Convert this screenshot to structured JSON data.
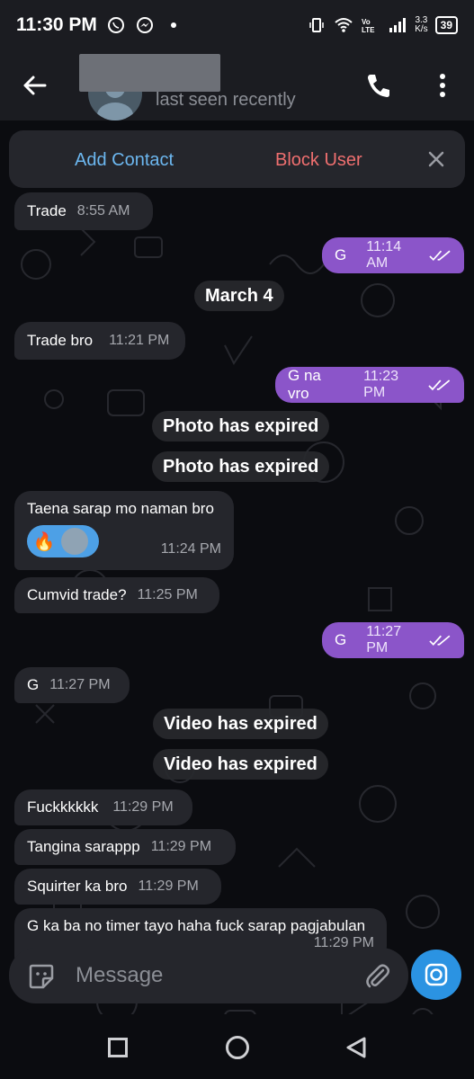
{
  "status_bar": {
    "time": "11:30 PM",
    "net_speed_top": "3.3",
    "net_speed_bottom": "K/s",
    "battery": "39",
    "icons": [
      "whatsapp-icon",
      "messenger-icon",
      "dot-icon",
      "vibrate-icon",
      "wifi-icon",
      "volte-icon",
      "signal-icon"
    ]
  },
  "header": {
    "status": "last seen recently",
    "icons": [
      "back-arrow-icon",
      "phone-icon",
      "more-vert-icon"
    ]
  },
  "contact_bar": {
    "add_contact": "Add Contact",
    "block_user": "Block User"
  },
  "messages": [
    {
      "dir": "in",
      "text": "Trade",
      "time": "8:55 AM"
    },
    {
      "dir": "out",
      "text": "G",
      "time": "11:14 AM",
      "read": true
    },
    {
      "dir": "date",
      "text": "March 4"
    },
    {
      "dir": "in",
      "text": "Trade bro",
      "time": "11:21 PM"
    },
    {
      "dir": "out",
      "text": "G na vro",
      "time": "11:23 PM",
      "read": true
    },
    {
      "dir": "system",
      "text": "Photo has expired"
    },
    {
      "dir": "system",
      "text": "Photo has expired"
    },
    {
      "dir": "in",
      "text": "Taena sarap mo naman bro",
      "time": "11:24 PM",
      "reaction": "🔥"
    },
    {
      "dir": "in",
      "text": "Cumvid trade?",
      "time": "11:25 PM"
    },
    {
      "dir": "out",
      "text": "G",
      "time": "11:27 PM",
      "read": true
    },
    {
      "dir": "in",
      "text": "G",
      "time": "11:27 PM"
    },
    {
      "dir": "system",
      "text": "Video has expired"
    },
    {
      "dir": "system",
      "text": "Video has expired"
    },
    {
      "dir": "in",
      "text": "Fuckkkkkk",
      "time": "11:29 PM"
    },
    {
      "dir": "in",
      "text": "Tangina sarappp",
      "time": "11:29 PM"
    },
    {
      "dir": "in",
      "text": "Squirter ka bro",
      "time": "11:29 PM"
    },
    {
      "dir": "in",
      "text": "G ka ba no timer tayo haha fuck sarap pagjabulan",
      "time": "11:29 PM"
    }
  ],
  "composer": {
    "placeholder": "Message",
    "icons": [
      "sticker-icon",
      "paperclip-icon",
      "camera-icon"
    ]
  },
  "colors": {
    "outgoing_bubble": "#8b55c9",
    "incoming_bubble": "#25262c",
    "accent_blue": "#2b93e2",
    "add_contact": "#6cb7f0",
    "block_user": "#ef6f6f"
  }
}
